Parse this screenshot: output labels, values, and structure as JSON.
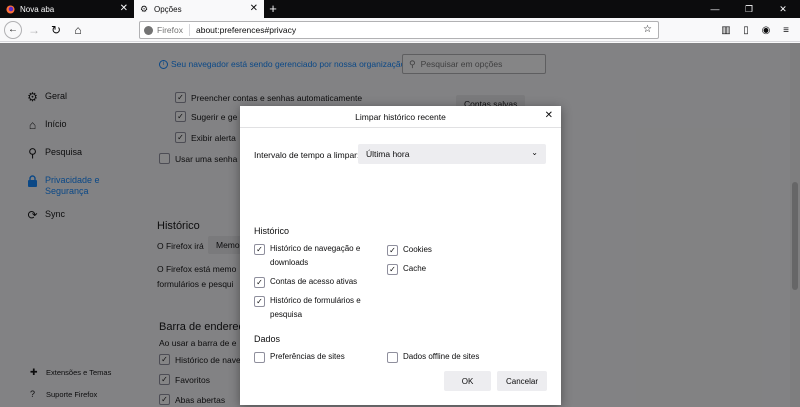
{
  "tabs": [
    {
      "title": "Nova aba",
      "active": false
    },
    {
      "title": "Opções",
      "active": true
    }
  ],
  "navbar": {
    "identity_label": "Firefox",
    "url": "about:preferences#privacy"
  },
  "policy_note": "Seu navegador está sendo gerenciado por nossa organização.",
  "search": {
    "placeholder": "Pesquisar em opções"
  },
  "sidebar": {
    "items": [
      {
        "label": "Geral",
        "icon": "gear-icon"
      },
      {
        "label": "Início",
        "icon": "home-icon"
      },
      {
        "label": "Pesquisa",
        "icon": "search-icon"
      },
      {
        "label": "Privacidade e Segurança",
        "icon": "lock-icon",
        "selected": true
      },
      {
        "label": "Sync",
        "icon": "sync-icon"
      }
    ],
    "bottom": [
      {
        "label": "Extensões e Temas",
        "icon": "puzzle-icon"
      },
      {
        "label": "Suporte Firefox",
        "icon": "help-icon"
      }
    ]
  },
  "background": {
    "autofill_label": "Preencher contas e senhas automaticamente",
    "suggest_label": "Sugerir e ge",
    "show_alerts_label": "Exibir alerta",
    "master_password_label": "Usar uma senha",
    "saved_logins_button": "Contas salvas",
    "history_heading": "Histórico",
    "firefox_will_label": "O Firefox irá",
    "firefox_will_select": "Memo",
    "history_desc_1": "O Firefox está memo",
    "history_desc_2": "formulários e pesqui",
    "address_bar_heading": "Barra de endereço",
    "address_bar_desc": "Ao usar a barra de e",
    "ab_history_label": "Histórico de navegação",
    "ab_bookmarks_label": "Favoritos",
    "ab_tabs_label": "Abas abertas"
  },
  "dialog": {
    "title": "Limpar histórico recente",
    "range_label": "Intervalo de tempo a limpar:",
    "range_value": "Última hora",
    "history_heading": "Histórico",
    "options": {
      "browsing": {
        "label": "Histórico de navegação e downloads",
        "checked": true
      },
      "logins": {
        "label": "Contas de acesso ativas",
        "checked": true
      },
      "forms": {
        "label": "Histórico de formulários e pesquisa",
        "checked": true
      },
      "cookies": {
        "label": "Cookies",
        "checked": true
      },
      "cache": {
        "label": "Cache",
        "checked": true
      }
    },
    "data_heading": "Dados",
    "data_options": {
      "site_prefs": {
        "label": "Preferências de sites",
        "checked": false
      },
      "offline": {
        "label": "Dados offline de sites",
        "checked": false
      }
    },
    "ok_label": "OK",
    "cancel_label": "Cancelar"
  }
}
